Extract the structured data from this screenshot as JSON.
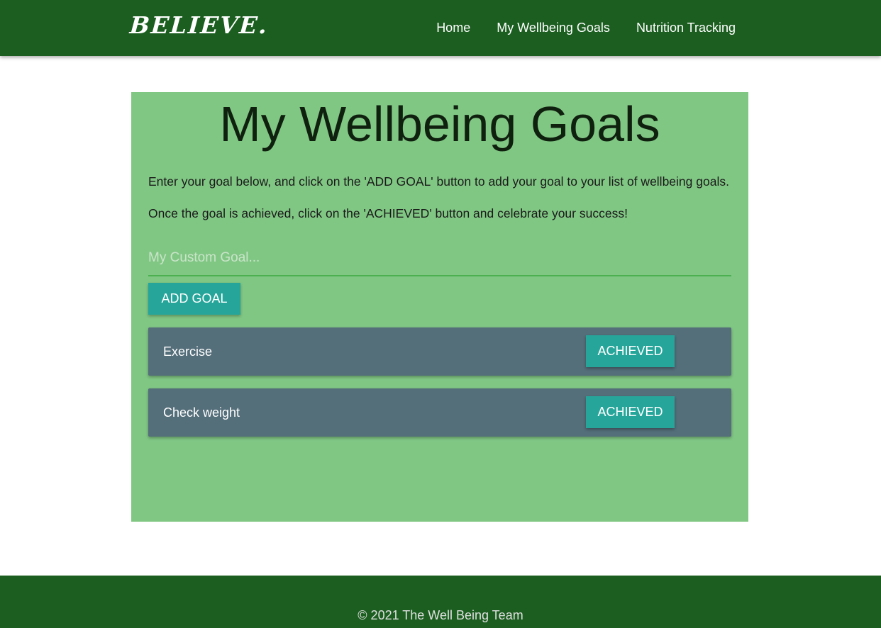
{
  "nav": {
    "brand": "BELIEVE.",
    "links": [
      {
        "label": "Home"
      },
      {
        "label": "My Wellbeing Goals"
      },
      {
        "label": "Nutrition Tracking"
      }
    ]
  },
  "main": {
    "title": "My Wellbeing Goals",
    "intro_1": "Enter your goal below, and click on the 'ADD GOAL' button to add your goal to your list of wellbeing goals.",
    "intro_2": "Once the goal is achieved, click on the 'ACHIEVED' button and celebrate your success!",
    "goal_input": {
      "placeholder": "My Custom Goal...",
      "value": ""
    },
    "add_button_label": "ADD GOAL",
    "goals": [
      {
        "text": "Exercise",
        "button_label": "ACHIEVED"
      },
      {
        "text": "Check weight",
        "button_label": "ACHIEVED"
      }
    ]
  },
  "footer": {
    "text": "© 2021 The Well Being Team"
  },
  "colors": {
    "nav_bg": "#1b5e20",
    "card_bg": "#81c784",
    "button": "#26a69a",
    "goal_item_bg": "#546e7a",
    "input_underline": "#4caf50"
  }
}
